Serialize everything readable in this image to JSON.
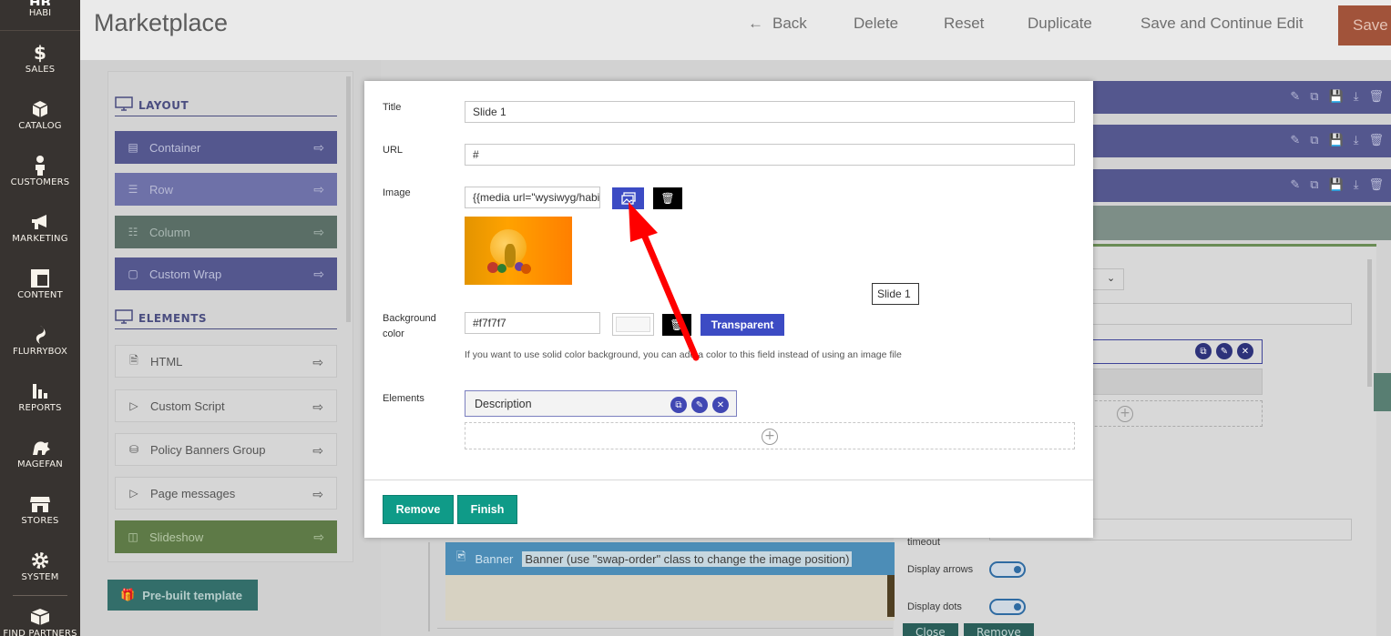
{
  "sidebar": {
    "logo_big": "HB",
    "logo_small": "HABI",
    "items": [
      {
        "label": "SALES",
        "icon": "dollar-icon"
      },
      {
        "label": "CATALOG",
        "icon": "cube-icon"
      },
      {
        "label": "CUSTOMERS",
        "icon": "person-icon"
      },
      {
        "label": "MARKETING",
        "icon": "megaphone-icon"
      },
      {
        "label": "CONTENT",
        "icon": "layout-icon"
      },
      {
        "label": "FLURRYBOX",
        "icon": "flurry-icon"
      },
      {
        "label": "REPORTS",
        "icon": "bar-chart-icon"
      },
      {
        "label": "MAGEFAN",
        "icon": "gorilla-icon"
      },
      {
        "label": "STORES",
        "icon": "store-icon"
      },
      {
        "label": "SYSTEM",
        "icon": "gear-icon"
      },
      {
        "label": "FIND PARTNERS",
        "icon": "box-icon"
      }
    ]
  },
  "header": {
    "title": "Marketplace",
    "back": "Back",
    "delete": "Delete",
    "reset": "Reset",
    "duplicate": "Duplicate",
    "save_continue": "Save and Continue Edit",
    "save": "Save"
  },
  "builder": {
    "layout_heading": "LAYOUT",
    "elements_heading": "ELEMENTS",
    "layout_items": [
      "Container",
      "Row",
      "Column",
      "Custom Wrap"
    ],
    "element_items": [
      "HTML",
      "Custom Script",
      "Policy Banners Group",
      "Page messages",
      "Slideshow"
    ],
    "prebuilt": "Pre-built template",
    "banner_label": "Banner",
    "banner_desc": "Banner (use \"swap-order\" class to change the image position)",
    "timeout_label": "timeout",
    "display_arrows": "Display arrows",
    "display_dots": "Display dots",
    "close_btn": "Close",
    "remove_btn": "Remove"
  },
  "modal": {
    "title_label": "Title",
    "title_value": "Slide 1",
    "url_label": "URL",
    "url_value": "#",
    "image_label": "Image",
    "image_value": "{{media url=\"wysiwyg/habi",
    "bg_label_1": "Background",
    "bg_label_2": "color",
    "bg_value": "#f7f7f7",
    "bg_swatch": "#f7f7f7",
    "transparent": "Transparent",
    "hint": "If you want to use solid color background, you can add a color to this field instead of using an image file",
    "elements_label": "Elements",
    "element_desc": "Description",
    "tooltip": "Slide 1",
    "remove": "Remove",
    "finish": "Finish"
  },
  "colors": {
    "accent_blue": "#3c4bc4",
    "teal": "#0f9b88",
    "arrow_red": "#ff0000"
  }
}
